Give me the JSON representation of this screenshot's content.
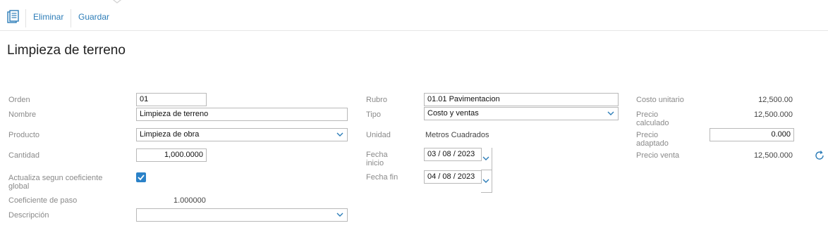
{
  "toolbar": {
    "icon": "document-list-icon",
    "eliminar_label": "Eliminar",
    "guardar_label": "Guardar"
  },
  "page_title": "Limpieza de terreno",
  "form": {
    "orden": {
      "label": "Orden",
      "value": "01"
    },
    "nombre": {
      "label": "Nombre",
      "value": "Limpieza de terreno"
    },
    "producto": {
      "label": "Producto",
      "value": "Limpieza de obra"
    },
    "cantidad": {
      "label": "Cantidad",
      "value": "1,000.0000"
    },
    "actualiza": {
      "label": "Actualiza segun coeficiente global",
      "checked": true
    },
    "coeficiente": {
      "label": "Coeficiente de paso",
      "value": "1.000000"
    },
    "descripcion": {
      "label": "Descripción",
      "value": ""
    },
    "rubro": {
      "label": "Rubro",
      "value": "01.01 Pavimentacion"
    },
    "tipo": {
      "label": "Tipo",
      "value": "Costo y ventas"
    },
    "unidad": {
      "label": "Unidad",
      "value": "Metros Cuadrados"
    },
    "fecha_inicio": {
      "label": "Fecha inicio",
      "value": "03 / 08 /  2023"
    },
    "fecha_fin": {
      "label": "Fecha fin",
      "value": "04 / 08 /  2023"
    },
    "costo_unitario": {
      "label": "Costo unitario",
      "value": "12,500.00"
    },
    "precio_calculado": {
      "label": "Precio calculado",
      "value": "12,500.000"
    },
    "precio_adaptado": {
      "label": "Precio adaptado",
      "value": "0.000"
    },
    "precio_venta": {
      "label": "Precio venta",
      "value": "12,500.000"
    }
  },
  "colors": {
    "accent": "#2d7db8",
    "checkbox": "#2b82c8",
    "label": "#8a8a8a"
  }
}
